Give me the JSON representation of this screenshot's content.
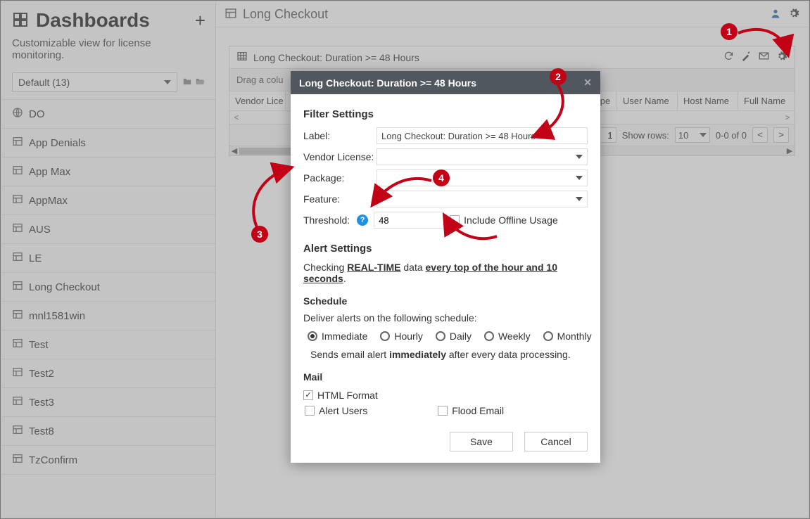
{
  "sidebar": {
    "title": "Dashboards",
    "subtitle": "Customizable view for license monitoring.",
    "select_label": "Default (13)",
    "items": [
      {
        "icon": "globe",
        "label": "DO"
      },
      {
        "icon": "layout",
        "label": "App Denials"
      },
      {
        "icon": "layout",
        "label": "App Max"
      },
      {
        "icon": "layout",
        "label": "AppMax"
      },
      {
        "icon": "layout",
        "label": "AUS"
      },
      {
        "icon": "layout",
        "label": "LE"
      },
      {
        "icon": "layout",
        "label": "Long Checkout"
      },
      {
        "icon": "layout",
        "label": "mnl1581win"
      },
      {
        "icon": "layout",
        "label": "Test"
      },
      {
        "icon": "layout",
        "label": "Test2"
      },
      {
        "icon": "layout",
        "label": "Test3"
      },
      {
        "icon": "layout",
        "label": "Test8"
      },
      {
        "icon": "layout",
        "label": "TzConfirm"
      }
    ]
  },
  "main": {
    "title": "Long Checkout"
  },
  "widget": {
    "title": "Long Checkout: Duration >= 48 Hours",
    "drag_hint": "Drag a colu",
    "columns": [
      "Vendor Lice",
      "Type",
      "User Name",
      "Host Name",
      "Full Name"
    ],
    "page_input": "1",
    "show_rows_label": "Show rows:",
    "show_rows_value": "10",
    "range_label": "0-0 of 0"
  },
  "modal": {
    "title": "Long Checkout: Duration >= 48 Hours",
    "filter_heading": "Filter Settings",
    "labels": {
      "label": "Label:",
      "vendor": "Vendor License:",
      "package": "Package:",
      "feature": "Feature:",
      "threshold": "Threshold:"
    },
    "label_value": "Long Checkout: Duration >= 48 Hours",
    "threshold_value": "48",
    "include_offline": "Include Offline Usage",
    "alert_heading": "Alert Settings",
    "alert_text_pre": "Checking ",
    "alert_text_b1": "REAL-TIME",
    "alert_text_mid": " data ",
    "alert_text_b2": "every top of the hour and 10 seconds",
    "alert_text_post": ".",
    "schedule_heading": "Schedule",
    "schedule_text": "Deliver alerts on the following schedule:",
    "schedule_options": [
      "Immediate",
      "Hourly",
      "Daily",
      "Weekly",
      "Monthly"
    ],
    "sends_pre": "Sends email alert ",
    "sends_b": "immediately",
    "sends_post": " after every data processing.",
    "mail_heading": "Mail",
    "mail_html": "HTML Format",
    "mail_alert_users": "Alert Users",
    "mail_flood": "Flood Email",
    "save_label": "Save",
    "cancel_label": "Cancel"
  }
}
